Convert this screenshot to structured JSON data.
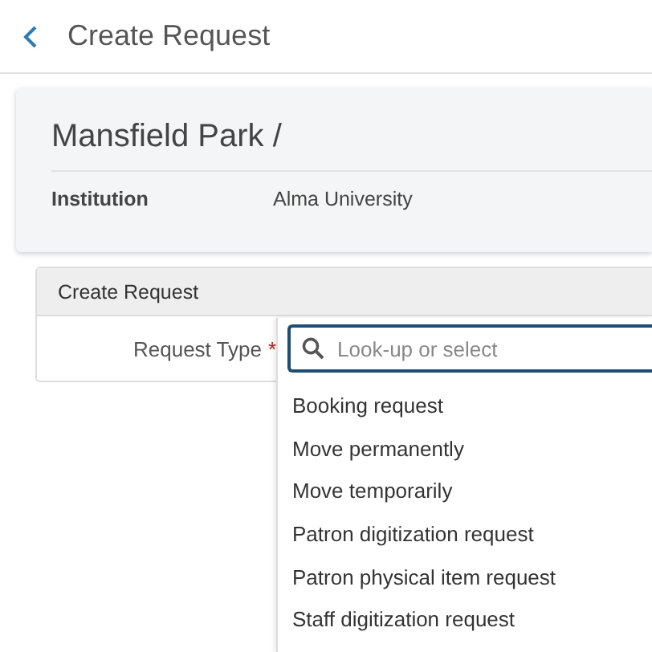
{
  "header": {
    "title": "Create Request"
  },
  "record": {
    "title": "Mansfield Park /",
    "fields": [
      {
        "label": "Institution",
        "value": "Alma University"
      }
    ]
  },
  "panel": {
    "title": "Create Request",
    "field": {
      "label": "Request Type",
      "required_mark": "*",
      "placeholder": "Look-up or select",
      "expanded": true
    }
  },
  "options": [
    {
      "label": "Booking request"
    },
    {
      "label": "Move permanently"
    },
    {
      "label": "Move temporarily"
    },
    {
      "label": "Patron digitization request"
    },
    {
      "label": "Patron physical item request"
    },
    {
      "label": "Staff digitization request"
    }
  ]
}
